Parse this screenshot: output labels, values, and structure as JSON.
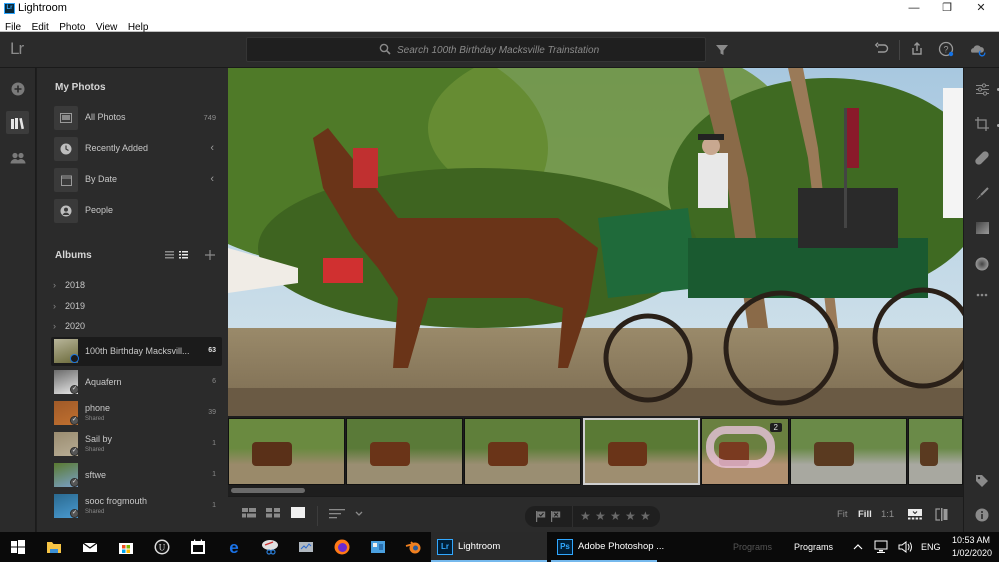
{
  "window": {
    "title": "Lightroom",
    "controls": {
      "minimize": "—",
      "maximize": "❐",
      "close": "✕"
    }
  },
  "menu": [
    "File",
    "Edit",
    "Photo",
    "View",
    "Help"
  ],
  "topbar": {
    "logo": "Lr",
    "search_placeholder": "Search 100th Birthday Macksville Trainstation",
    "icons": [
      "filter-icon",
      "undo-icon",
      "share-icon",
      "help-icon",
      "cloud-sync-icon"
    ]
  },
  "rail": {
    "items": [
      {
        "name": "add-photos",
        "active": false
      },
      {
        "name": "library",
        "active": true
      },
      {
        "name": "people",
        "active": false
      }
    ]
  },
  "my_photos": {
    "title": "My Photos",
    "items": [
      {
        "label": "All Photos",
        "count": "749",
        "icon": "photo-icon"
      },
      {
        "label": "Recently Added",
        "icon": "clock-icon",
        "chevron": "‹"
      },
      {
        "label": "By Date",
        "icon": "calendar-icon",
        "chevron": "‹"
      },
      {
        "label": "People",
        "icon": "person-icon"
      }
    ]
  },
  "albums": {
    "title": "Albums",
    "years": [
      "2018",
      "2019",
      "2020"
    ],
    "items": [
      {
        "name": "100th Birthday Macksvill...",
        "count": "63",
        "selected": true,
        "shared": false,
        "syncing": true,
        "thumb": [
          "#6b6a3a",
          "#b8b59a"
        ]
      },
      {
        "name": "Aquafern",
        "count": "6",
        "selected": false,
        "shared": false,
        "thumb": [
          "#e8e8e8",
          "#6b6b6b"
        ]
      },
      {
        "name": "phone",
        "sub": "Shared",
        "count": "39",
        "selected": false,
        "shared": true,
        "thumb": [
          "#c07030",
          "#a05a28"
        ]
      },
      {
        "name": "Sail by",
        "sub": "Shared",
        "count": "1",
        "selected": false,
        "shared": true,
        "thumb": [
          "#b8ad95",
          "#9a8c70"
        ]
      },
      {
        "name": "sftwe",
        "count": "1",
        "selected": false,
        "shared": false,
        "thumb": [
          "#7aa0c8",
          "#5a7a30"
        ]
      },
      {
        "name": "sooc frogmouth",
        "sub": "Shared",
        "count": "1",
        "selected": false,
        "shared": true,
        "thumb": [
          "#4a9ad0",
          "#2a6a90"
        ]
      }
    ]
  },
  "filmstrip": {
    "thumbs": [
      {
        "selected": false
      },
      {
        "selected": false
      },
      {
        "selected": false
      },
      {
        "selected": true
      },
      {
        "selected": false,
        "stack_count": "2",
        "masked": true
      },
      {
        "selected": false
      },
      {
        "selected": false
      }
    ]
  },
  "bottombar": {
    "view_modes": [
      "square-grid-icon",
      "photo-grid-icon",
      "detail-view-icon"
    ],
    "sort_icon": "sort-icon",
    "flags": [
      "flag-pick-icon",
      "flag-reject-icon"
    ],
    "stars_total": 5,
    "rating": 0,
    "zoom_options": [
      {
        "label": "Fit",
        "active": false
      },
      {
        "label": "Fill",
        "active": true
      },
      {
        "label": "1:1",
        "active": false
      }
    ]
  },
  "right_panel": {
    "tools": [
      "edit-sliders-icon",
      "crop-icon",
      "healing-icon",
      "brush-icon",
      "linear-gradient-icon",
      "radial-gradient-icon",
      "more-icon"
    ],
    "bottom_tools": [
      "keywords-tag-icon",
      "info-icon"
    ]
  },
  "taskbar": {
    "pinned": [
      "start",
      "file-explorer",
      "mail",
      "store",
      "unreal-engine",
      "calendar",
      "edge",
      "snipping-tool",
      "performance-monitor",
      "firefox",
      "control-panel",
      "blender"
    ],
    "tasks": [
      {
        "badge": "Lr",
        "label": "Lightroom",
        "active": true,
        "color": "#31a8ff"
      },
      {
        "badge": "Ps",
        "label": "Adobe Photoshop ...",
        "active": false,
        "color": "#31a8ff"
      }
    ],
    "toolbars": [
      "Programs",
      "Programs"
    ],
    "language": "ENG",
    "time": "10:53 AM",
    "date": "1/02/2020"
  }
}
